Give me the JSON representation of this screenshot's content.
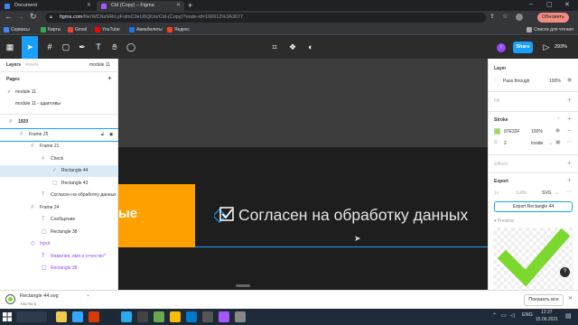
{
  "browser": {
    "tabs": [
      {
        "title": "Document",
        "active": false
      },
      {
        "title": "Cld (Copy) – Figma",
        "active": true
      }
    ],
    "new_tab_label": "+",
    "url_host": "figma.com",
    "url_path": "/file/WCNsNRrLyFslmC0eU6QiUo/Cld-(Copy)?node-id=166612%3A3077",
    "update_button": "Обновить",
    "bookmarks": [
      {
        "label": "Сервисы",
        "color": "#4285f4"
      },
      {
        "label": "Карты",
        "color": "#34a853"
      },
      {
        "label": "Gmail",
        "color": "#ea4335"
      },
      {
        "label": "YouTube",
        "color": "#ff0000"
      },
      {
        "label": "Авиабилеты",
        "color": "#1a73e8"
      },
      {
        "label": "Яндекс",
        "color": "#fc3f1d"
      }
    ],
    "reading_list": "Список для чтения"
  },
  "figma_toolbar": {
    "share": "Share",
    "zoom": "293%",
    "avatar_letter": "I"
  },
  "left_panel": {
    "tab_layers": "Layers",
    "tab_assets": "Assets",
    "page_selector": "module 11",
    "pages_title": "Pages",
    "pages": [
      "module 11",
      "module 11 - адаптивы"
    ],
    "layers": [
      {
        "name": "1920",
        "depth": 0,
        "icon": "#",
        "bold": true
      },
      {
        "name": "Frame 25",
        "depth": 1,
        "icon": "#",
        "selected_outline": true
      },
      {
        "name": "Frame 21",
        "depth": 2,
        "icon": "#"
      },
      {
        "name": "Check",
        "depth": 3,
        "icon": "#"
      },
      {
        "name": "Rectangle 44",
        "depth": 4,
        "icon": "✓",
        "selected": true
      },
      {
        "name": "Rectangle 43",
        "depth": 4,
        "icon": "▢"
      },
      {
        "name": "Согласен на обработку данных",
        "depth": 3,
        "icon": "T"
      },
      {
        "name": "Frame 24",
        "depth": 2,
        "icon": "#"
      },
      {
        "name": "Сообщение",
        "depth": 3,
        "icon": "T"
      },
      {
        "name": "Rectangle 38",
        "depth": 3,
        "icon": "▢"
      },
      {
        "name": "Input",
        "depth": 2,
        "icon": "◇",
        "component": true
      },
      {
        "name": "Фамилия, имя и отчество*",
        "depth": 3,
        "icon": "T",
        "component": true
      },
      {
        "name": "Rectangle 38",
        "depth": 3,
        "icon": "▢",
        "component": true
      }
    ]
  },
  "canvas": {
    "orange_text": "ые",
    "consent_text": "Согласен на обработку данных",
    "accent_color": "#ff9f00",
    "selection_color": "#18a0fb"
  },
  "right_panel": {
    "layer_title": "Layer",
    "blend_mode": "Pass through",
    "opacity": "100%",
    "fill_title": "Fill",
    "stroke_title": "Stroke",
    "stroke_color_hex": "97E33F",
    "stroke_color": "#97e33f",
    "stroke_opacity": "100%",
    "stroke_width": "2",
    "stroke_position": "Inside",
    "effects_title": "Effects",
    "export_title": "Export",
    "export_scale": "1x",
    "export_suffix": "Suffix",
    "export_format": "SVG",
    "export_button": "Export Rectangle 44",
    "preview_label": "Preview"
  },
  "download": {
    "filename": "Rectangle 44.svg",
    "size": "796/796 Б",
    "show_all": "Показать все"
  },
  "taskbar": {
    "lang": "ENG",
    "time": "12:37",
    "date": "15.06.2021",
    "apps": [
      {
        "name": "explorer",
        "color": "#f2c94c"
      },
      {
        "name": "photoshop",
        "color": "#31a8ff"
      },
      {
        "name": "office",
        "color": "#d83b01"
      },
      {
        "name": "steam",
        "color": "#1b2838"
      },
      {
        "name": "telegram",
        "color": "#2aabee"
      },
      {
        "name": "headphones",
        "color": "#444"
      },
      {
        "name": "paint",
        "color": "#6aa84f"
      },
      {
        "name": "chrome",
        "color": "#fbbc05"
      },
      {
        "name": "vscode",
        "color": "#007acc"
      },
      {
        "name": "terminal",
        "color": "#555"
      },
      {
        "name": "figma",
        "color": "#a259ff"
      },
      {
        "name": "app",
        "color": "#888"
      }
    ]
  }
}
